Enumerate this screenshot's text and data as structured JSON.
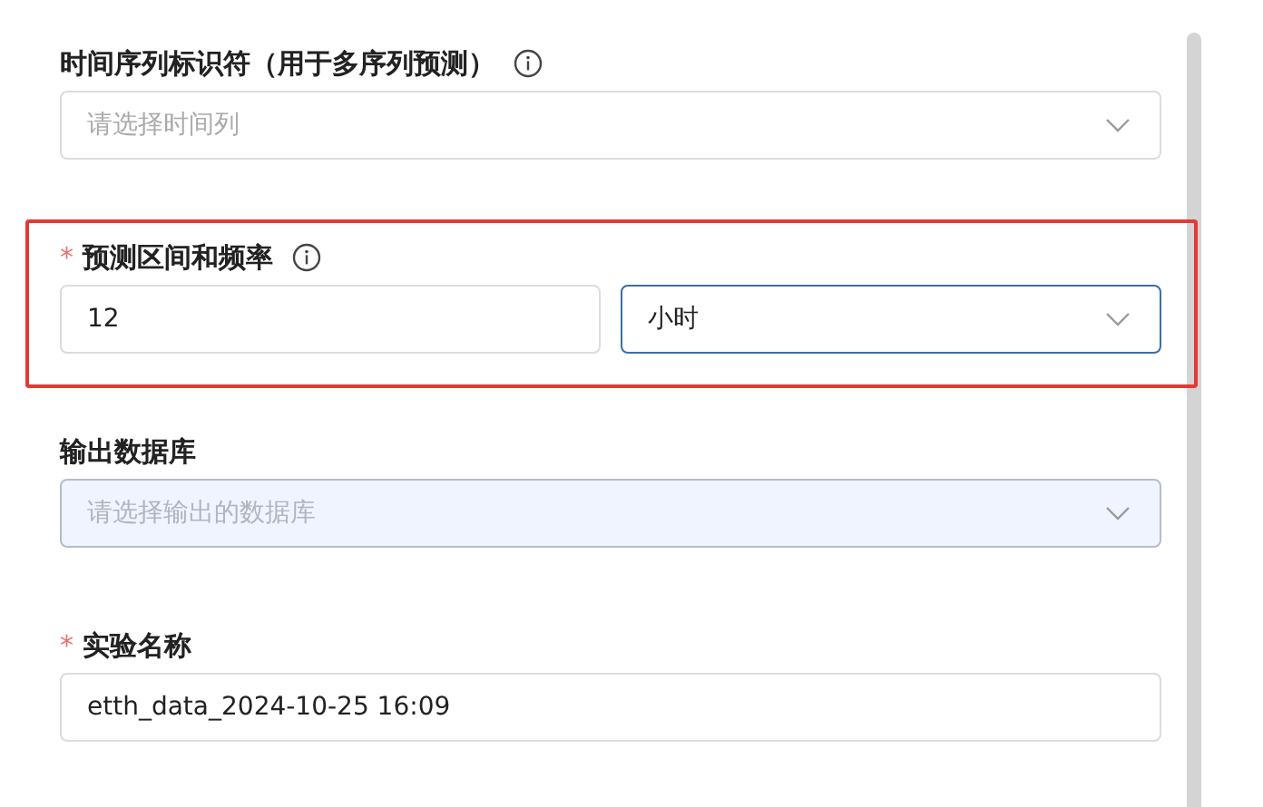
{
  "form_items": [
    {
      "kind": "select",
      "label": "时间序列标识符（用于多序列预测）",
      "info": true,
      "highlighted": false,
      "disabled": false,
      "placeholder": "请选择时间列"
    },
    {
      "kind": "pair",
      "required_mark": "*",
      "label": "预测区间和频率",
      "info": true,
      "highlighted": true,
      "value": "12",
      "unit": "小时"
    },
    {
      "kind": "select",
      "label": "输出数据库",
      "highlighted": false,
      "disabled": true,
      "placeholder": "请选择输出的数据库"
    },
    {
      "kind": "text",
      "required_mark": "*",
      "label": "实验名称",
      "highlighted": false,
      "value": "etth_data_2024-10-25 16:09"
    }
  ]
}
